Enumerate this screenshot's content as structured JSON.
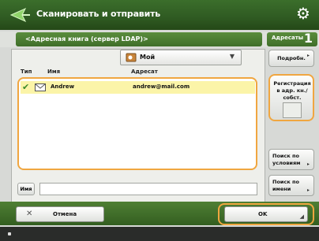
{
  "window": {
    "title": "Сканировать и отправить",
    "app_icon": "send-arrow-icon",
    "settings_icon": "gear-icon"
  },
  "header": {
    "address_book_label": "<Адресная книга (сервер LDAP)>",
    "destinations_label": "Адресаты",
    "destinations_count": "1"
  },
  "dropdown": {
    "icon": "address-book-icon",
    "value": "Мой"
  },
  "list": {
    "columns": [
      "Тип",
      "Имя",
      "Адресат"
    ],
    "rows": [
      {
        "checked": true,
        "type_icon": "email-icon",
        "name": "Andrew",
        "address": "andrew@mail.com"
      }
    ]
  },
  "side_buttons": {
    "details": "Подробн.",
    "register": "Регистрация в адр. кн./собст.",
    "register_line1": "Регистрация",
    "register_line2": "в адр. кн./",
    "register_line3": "собст.",
    "prev_line1": "Поиск по",
    "prev_line2": "условиям",
    "next_line1": "Поиск по",
    "next_line2": "имени"
  },
  "search": {
    "label": "Имя",
    "value": ""
  },
  "footer_buttons": {
    "cancel": "Отмена",
    "ok": "OK"
  },
  "colors": {
    "title_green": "#2f5a22",
    "highlight_orange": "#f0a640",
    "selected_row": "#fbf4a8"
  }
}
